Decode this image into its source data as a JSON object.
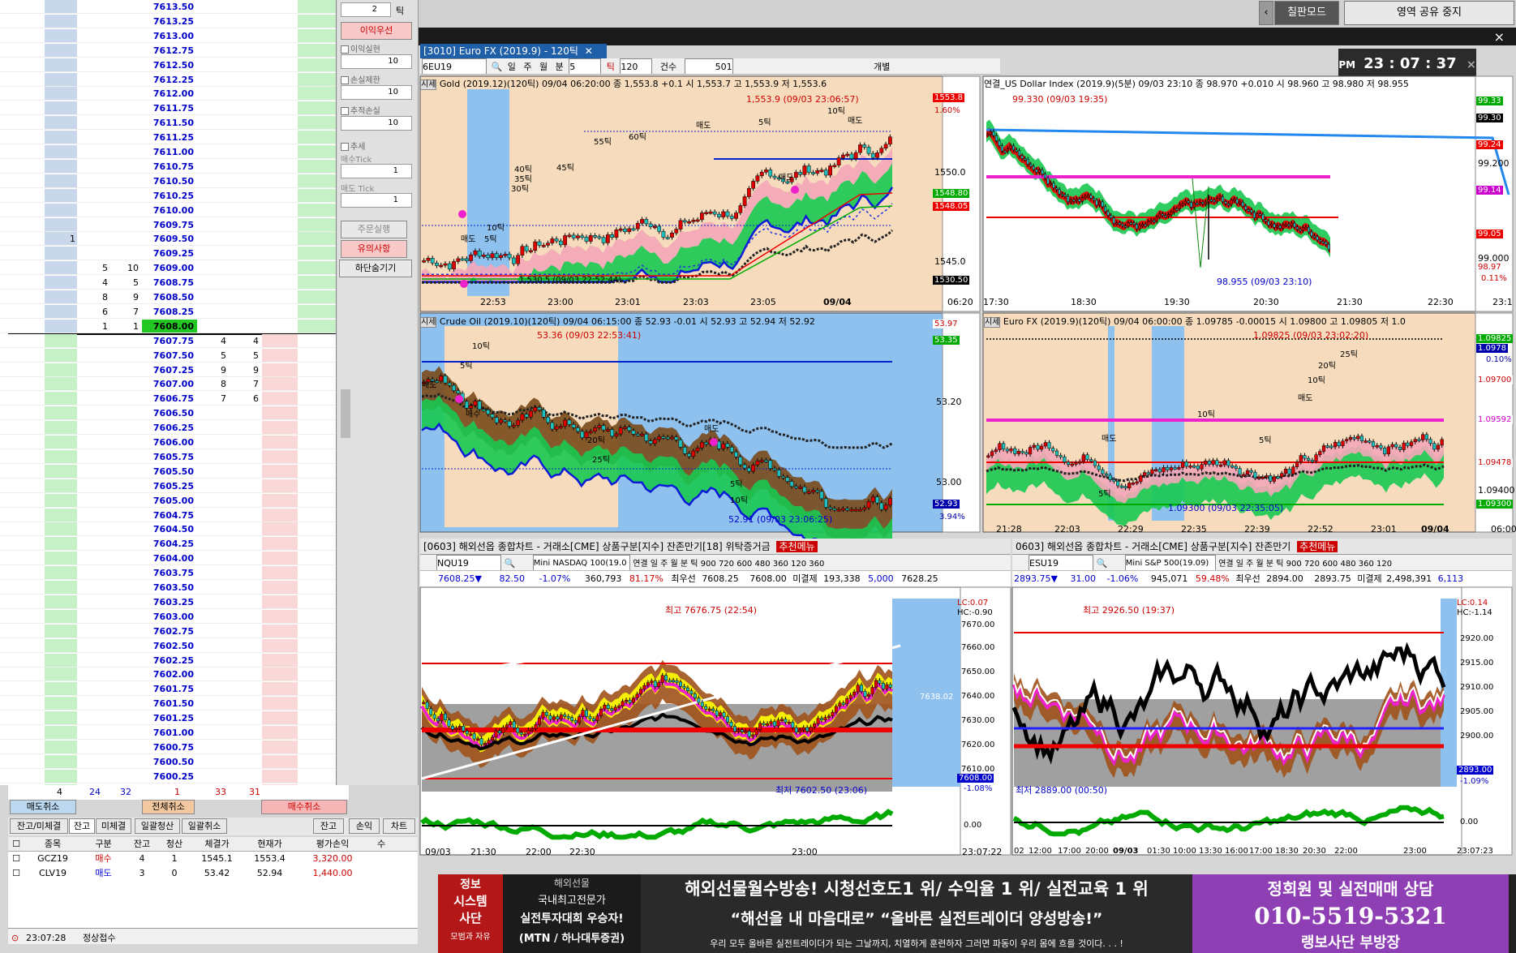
{
  "book": {
    "upper": [
      {
        "price": "7613.50"
      },
      {
        "price": "7613.25"
      },
      {
        "price": "7613.00"
      },
      {
        "price": "7612.75"
      },
      {
        "price": "7612.50"
      },
      {
        "price": "7612.25"
      },
      {
        "price": "7612.00"
      },
      {
        "price": "7611.75"
      },
      {
        "price": "7611.50"
      },
      {
        "price": "7611.25"
      },
      {
        "price": "7611.00"
      },
      {
        "price": "7610.75"
      },
      {
        "price": "7610.50"
      },
      {
        "price": "7610.25"
      },
      {
        "price": "7610.00"
      },
      {
        "price": "7609.75"
      },
      {
        "price": "7609.50",
        "a": "1"
      },
      {
        "price": "7609.25"
      },
      {
        "price": "7609.00",
        "b": "5",
        "c": "10"
      },
      {
        "price": "7608.75",
        "b": "4",
        "c": "5"
      },
      {
        "price": "7608.50",
        "b": "8",
        "c": "9"
      },
      {
        "price": "7608.25",
        "b": "6",
        "c": "7"
      },
      {
        "price": "7608.00",
        "b": "1",
        "c": "1",
        "cur": true
      }
    ],
    "lower": [
      {
        "price": "7607.75",
        "d": "4",
        "e": "4"
      },
      {
        "price": "7607.50",
        "d": "5",
        "e": "5"
      },
      {
        "price": "7607.25",
        "d": "9",
        "e": "9"
      },
      {
        "price": "7607.00",
        "d": "8",
        "e": "7"
      },
      {
        "price": "7606.75",
        "d": "7",
        "e": "6"
      },
      {
        "price": "7606.50"
      },
      {
        "price": "7606.25"
      },
      {
        "price": "7606.00"
      },
      {
        "price": "7605.75"
      },
      {
        "price": "7605.50"
      },
      {
        "price": "7605.25"
      },
      {
        "price": "7605.00"
      },
      {
        "price": "7604.75"
      },
      {
        "price": "7604.50"
      },
      {
        "price": "7604.25"
      },
      {
        "price": "7604.00"
      },
      {
        "price": "7603.75"
      },
      {
        "price": "7603.50"
      },
      {
        "price": "7603.25"
      },
      {
        "price": "7603.00"
      },
      {
        "price": "7602.75"
      },
      {
        "price": "7602.50"
      },
      {
        "price": "7602.25"
      },
      {
        "price": "7602.00"
      },
      {
        "price": "7601.75"
      },
      {
        "price": "7601.50"
      },
      {
        "price": "7601.25"
      },
      {
        "price": "7601.00"
      },
      {
        "price": "7600.75"
      },
      {
        "price": "7600.50"
      },
      {
        "price": "7600.25"
      },
      {
        "price": "7600.00"
      },
      {
        "price": "7599.75"
      },
      {
        "price": "7599.50"
      }
    ],
    "totals": [
      "4",
      "24",
      "32",
      "1",
      "33",
      "31"
    ],
    "btn_sell_cancel": "매도취소",
    "btn_all_cancel": "전체취소",
    "btn_buy_cancel": "매수취소"
  },
  "ctrl": {
    "tick_val": "2",
    "tick_unit": "틱",
    "profit_first": "이익우선",
    "chk_profit": "이익실현",
    "val_profit": "10",
    "chk_loss": "손실제한",
    "val_loss": "10",
    "chk_trail": "추적손실",
    "val_trail": "10",
    "chk_add": "추세",
    "buy_tick": "매수Tick",
    "val_buy": "1",
    "sell_tick": "매도 Tick",
    "val_sell": "1",
    "order_exec": "주문실행",
    "notice": "유의사항",
    "hide": "하단숨기기"
  },
  "tabs": {
    "items": [
      "잔고/미체결",
      "잔고",
      "미체결",
      "일괄청산",
      "일괄취소"
    ],
    "right": [
      "잔고",
      "손익",
      "차트"
    ]
  },
  "ptable": {
    "headers": [
      "종목",
      "구분",
      "잔고",
      "청산",
      "체결가",
      "현재가",
      "평가손익",
      "수"
    ],
    "rows": [
      {
        "sym": "GCZ19",
        "side": "매수",
        "bal": "4",
        "clr": "1",
        "fill": "1545.1",
        "cur": "1553.4",
        "pnl": "3,320.00"
      },
      {
        "sym": "CLV19",
        "side": "매도",
        "bal": "3",
        "clr": "0",
        "fill": "53.42",
        "cur": "52.94",
        "pnl": "1,440.00"
      }
    ]
  },
  "status": {
    "time": "23:07:28",
    "text": "정상접수"
  },
  "top": {
    "btn1": "칠판모드",
    "btn2": "영역 공유 중지",
    "close": "×"
  },
  "clock": {
    "ampm": "PM",
    "time": "23 : 07 : 37"
  },
  "eurwin": {
    "title": "[3010] Euro FX (2019.9) - 120틱",
    "sym": "6EU19",
    "t1": "일",
    "t2": "주",
    "t3": "월",
    "t4": "분",
    "t5": "5",
    "t6": "틱",
    "t7": "120",
    "t8": "건수",
    "t9": "501",
    "t10": "개별"
  },
  "gold": {
    "tag": "시세",
    "title": "Gold (2019.12)(120틱) 09/04 06:20:00  종 1,553.8 +0.1  시 1,553.7 고 1,553.9 저 1,553.6",
    "hi": "1,553.9 (09/03 23:06:57)",
    "r1": "1553.8",
    "r1p": "1.60%",
    "r2": "1550.0",
    "r3": "1548.80",
    "r4": "1548.05",
    "r5": "1545.0",
    "r6": "1530.50",
    "lo": "1,530.5 (09/03 22:52:44)",
    "x": [
      "22:53",
      "23:00",
      "23:01",
      "23:03",
      "23:05",
      "09/04"
    ],
    "end": "06:20",
    "labels": [
      "55틱",
      "60틱",
      "45틱",
      "40틱",
      "35틱",
      "30틱",
      "10틱",
      "5틱",
      "5틱",
      "10틱",
      "매도",
      "매도",
      "매도",
      "매도"
    ]
  },
  "usd": {
    "title": "연결_US Dollar Index (2019.9)(5분) 09/03 23:10  종 98.970 +0.010  시 98.960 고 98.980 저 98.955",
    "hi": "99.330 (09/03 19:35)",
    "lo": "98.955 (09/03 23:10)",
    "r": [
      "99.33",
      "99.30",
      "99.24",
      "99.200",
      "99.14",
      "99.05",
      "99.000",
      "98.97",
      "0.11%"
    ],
    "x": [
      "17:30",
      "18:30",
      "19:30",
      "20:30",
      "21:30",
      "22:30",
      "23:1"
    ]
  },
  "crude": {
    "tag": "시세",
    "title": "Crude Oil (2019.10)(120틱) 09/04 06:15:00  종 52.93 -0.01  시 52.93 고 52.94 저 52.92",
    "hi": "53.36 (09/03 22:53:41)",
    "lo": "52.91 (09/03 23:06:25)",
    "r": [
      "53.97",
      "53.35",
      "53.20",
      "53.00",
      "52.93",
      "3.94%"
    ],
    "labels": [
      "10틱",
      "5틱",
      "매도",
      "매수",
      "20틱",
      "25틱",
      "5틱",
      "10틱",
      "매도"
    ]
  },
  "euro": {
    "tag": "시세",
    "title": "Euro FX (2019.9)(120틱) 09/04 06:00:00  종 1.09785 -0.00015  시 1.09800 고 1.09805 저 1.0",
    "hi": "1.09825 (09/03 23:02:20)",
    "lo": "1.09300 (09/03 22:35:05)",
    "r": [
      "1.09825",
      "1.0978",
      "0.10%",
      "1.09700",
      "1.09592",
      "1.09478",
      "1.09400",
      "1.09300"
    ],
    "x": [
      "21:28",
      "22:03",
      "22:29",
      "22:35",
      "22:39",
      "22:52",
      "23:01",
      "09/04",
      "06:00"
    ],
    "labels": [
      "20틱",
      "25틱",
      "10틱",
      "10틱",
      "5틱",
      "5틱",
      "매도",
      "매도"
    ]
  },
  "nq": {
    "title": "[0603] 해외선옵 종합차트 - 거래소[CME] 상품구분[지수] 잔존만기[18] 위탁증거금",
    "reco": "추천메뉴",
    "sym": "NQU19",
    "name": "Mini NASDAQ 100(19.0",
    "row1": "연결 일 주 월 분 틱 900 720 600 480 360 120 360",
    "price": "7608.25",
    "chg": "82.50",
    "pct": "-1.07%",
    "vol": "360,793",
    "volp": "81.17%",
    "bestsell_lbl": "최우선",
    "bestsell": "7608.25",
    "bestbuy": "7608.00",
    "unfill_lbl": "미결제",
    "unfill": "193,338",
    "unfill2": "5,000",
    "ask": "7628.25",
    "hi": "최고 7676.75 (22:54)",
    "lo": "최저 7602.50 (23:06)",
    "lc": "LC:0.07",
    "hc": "HC:-0.90",
    "r": [
      "7670.00",
      "7660.00",
      "7650.00",
      "7640.00",
      "7630.00",
      "7620.00",
      "7610.00",
      "7608.00",
      "-1.08%",
      "7638.02"
    ],
    "sub": "0.00",
    "x": [
      "09/03",
      "21:30",
      "22:00",
      "22:30",
      "23:00",
      "23:07:22"
    ]
  },
  "es": {
    "title": "0603] 해외선옵 종합차트 - 거래소[CME] 상품구분[지수] 잔존만기",
    "reco": "추천메뉴",
    "sym": "ESU19",
    "name": "Mini S&P 500(19.09)",
    "row1": "연결 일 주 월 분 틱 900 720 600 480 360 120",
    "price": "2893.75",
    "chg": "31.00",
    "pct": "-1.06%",
    "vol": "945,071",
    "volp": "59.48%",
    "bestsell_lbl": "최우선",
    "bestsell": "2894.00",
    "bestbuy": "2893.75",
    "unfill_lbl": "미결제",
    "unfill": "2,498,391",
    "unfill2": "6,113",
    "hi": "최고 2926.50 (19:37)",
    "lo": "최저 2889.00 (00:50)",
    "lc": "LC:0.14",
    "hc": "HC:-1.14",
    "r": [
      "2920.00",
      "2915.00",
      "2910.00",
      "2905.00",
      "2900.00",
      "2893.00",
      "-1.09%"
    ],
    "sub": "0.00",
    "x": [
      "02",
      "12:00",
      "17:00",
      "20:00",
      "09/03",
      "01:30",
      "10:00",
      "13:30",
      "16:00",
      "17:00",
      "18:30",
      "20:30",
      "22:00",
      "23:00",
      "23:07:23"
    ]
  },
  "ad": {
    "b1a": "정보",
    "b1b": "시스템",
    "b1c": "사단",
    "b1d": "모범과 자유",
    "b2a": "해외선물",
    "b2b": "국내최고전문가",
    "b2c": "실전투자대회 우승자!",
    "b2d": "(MTN / 하나대투증권)",
    "b3a": "해외선물월수방송! 시청선호도1 위/ 수익율 1 위/ 실전교육 1 위",
    "b3b": "“해선을 내 마음대로” “올바른 실전트레이더 양성방송!”",
    "b3c": "우리 모두 올바른 실전트레이더가 되는 그날까지, 치열하게 훈련하자 그러면 파동이 우리 몸에 흐를 것이다. . . !",
    "b4a": "정회원 및 실전매매 상담",
    "b4b": "010-5519-5321",
    "b4c": "랭보사단 부방장"
  }
}
